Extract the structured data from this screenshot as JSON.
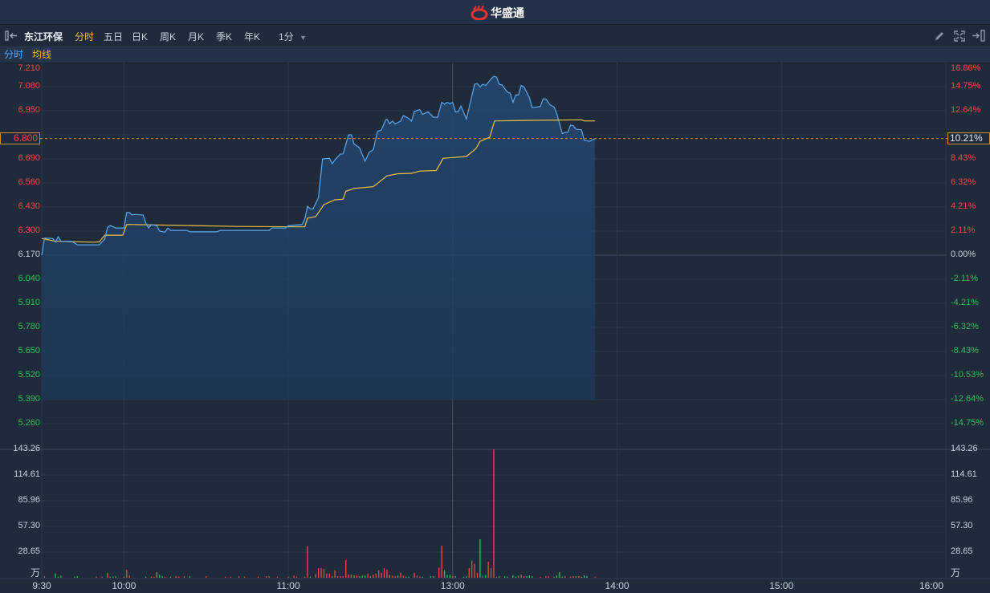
{
  "header": {
    "logo_text": "华盛通"
  },
  "toolbar": {
    "stock_name": "东江环保",
    "tabs": [
      "分时",
      "五日",
      "日K",
      "周K",
      "月K",
      "季K",
      "年K"
    ],
    "active_tab": "分时",
    "interval": "1分"
  },
  "legend": {
    "line1": "分时",
    "line2": "均线"
  },
  "colors": {
    "up": "#e84a4a",
    "down": "#2fbf5c",
    "price_line": "#5aa9f0",
    "avg_line": "#f0c040",
    "accent": "#f0b93a"
  },
  "axis": {
    "price_labels": [
      "7.210",
      "7.080",
      "6.950",
      "",
      "6.690",
      "6.560",
      "6.430",
      "6.300",
      "6.170",
      "6.040",
      "5.910",
      "5.780",
      "5.650",
      "5.520",
      "5.390",
      "5.260"
    ],
    "pct_labels": [
      "16.86%",
      "14.75%",
      "12.64%",
      "",
      "8.43%",
      "6.32%",
      "4.21%",
      "2.11%",
      "0.00%",
      "-2.11%",
      "-4.21%",
      "-6.32%",
      "-8.43%",
      "-10.53%",
      "-12.64%",
      "-14.75%"
    ],
    "volume_labels": [
      "143.26",
      "114.61",
      "85.96",
      "57.30",
      "28.65"
    ],
    "volume_unit": "万",
    "time_labels": [
      "9:30",
      "10:00",
      "11:00",
      "13:00",
      "14:00",
      "15:00",
      "16:00"
    ],
    "current_price": "6.800",
    "current_pct": "10.21%"
  },
  "chart_data": {
    "type": "line",
    "title": "东江环保 分时",
    "prev_close": 6.17,
    "ylim": [
      5.13,
      7.245
    ],
    "x_unit": "trading minutes since 9:30 (11:30/13:00 merged)",
    "xlim": [
      0,
      330
    ],
    "price": [
      [
        0,
        6.17
      ],
      [
        1,
        6.262
      ],
      [
        4,
        6.26
      ],
      [
        5,
        6.24
      ],
      [
        6,
        6.27
      ],
      [
        7,
        6.245
      ],
      [
        11,
        6.245
      ],
      [
        13,
        6.226
      ],
      [
        21,
        6.226
      ],
      [
        23,
        6.257
      ],
      [
        24,
        6.32
      ],
      [
        25,
        6.33
      ],
      [
        27,
        6.317
      ],
      [
        30,
        6.317
      ],
      [
        31,
        6.4
      ],
      [
        32,
        6.4
      ],
      [
        33,
        6.387
      ],
      [
        34,
        6.39
      ],
      [
        37,
        6.387
      ],
      [
        38,
        6.343
      ],
      [
        39,
        6.317
      ],
      [
        40,
        6.335
      ],
      [
        42,
        6.33
      ],
      [
        43,
        6.3
      ],
      [
        45,
        6.295
      ],
      [
        46,
        6.317
      ],
      [
        47,
        6.304
      ],
      [
        53,
        6.304
      ],
      [
        54,
        6.296
      ],
      [
        64,
        6.296
      ],
      [
        65,
        6.304
      ],
      [
        83,
        6.304
      ],
      [
        84,
        6.317
      ],
      [
        89,
        6.317
      ],
      [
        90,
        6.33
      ],
      [
        95,
        6.335
      ],
      [
        96,
        6.365
      ],
      [
        97,
        6.434
      ],
      [
        98,
        6.42
      ],
      [
        99,
        6.42
      ],
      [
        101,
        6.48
      ],
      [
        102.5,
        6.69
      ],
      [
        105,
        6.693
      ],
      [
        106,
        6.664
      ],
      [
        107,
        6.684
      ],
      [
        109,
        6.716
      ],
      [
        110,
        6.717
      ],
      [
        112,
        6.82
      ],
      [
        113,
        6.82
      ],
      [
        114,
        6.77
      ],
      [
        116,
        6.75
      ],
      [
        118,
        6.677
      ],
      [
        119.5,
        6.725
      ],
      [
        121,
        6.74
      ],
      [
        122.5,
        6.837
      ],
      [
        124,
        6.847
      ],
      [
        125.5,
        6.9
      ],
      [
        126,
        6.904
      ],
      [
        127,
        6.88
      ],
      [
        128,
        6.894
      ],
      [
        129,
        6.879
      ],
      [
        131,
        6.894
      ],
      [
        132,
        6.924
      ],
      [
        134,
        6.908
      ],
      [
        135,
        6.894
      ],
      [
        136,
        6.946
      ],
      [
        138,
        6.956
      ],
      [
        139,
        6.93
      ],
      [
        141,
        6.944
      ],
      [
        143,
        6.915
      ],
      [
        144.5,
        6.915
      ],
      [
        146,
        6.996
      ],
      [
        147,
        6.985
      ],
      [
        148,
        6.996
      ],
      [
        149,
        6.988
      ],
      [
        150,
        6.995
      ],
      [
        151,
        6.944
      ],
      [
        152,
        6.944
      ],
      [
        153,
        6.975
      ],
      [
        155,
        6.905
      ],
      [
        158,
        7.093
      ],
      [
        159,
        7.097
      ],
      [
        160,
        7.079
      ],
      [
        161,
        7.093
      ],
      [
        162,
        7.086
      ],
      [
        164,
        7.122
      ],
      [
        165,
        7.136
      ],
      [
        166,
        7.132
      ],
      [
        167,
        7.093
      ],
      [
        168,
        7.089
      ],
      [
        170,
        7.05
      ],
      [
        171,
        7.045
      ],
      [
        172,
        6.996
      ],
      [
        173,
        7.035
      ],
      [
        174,
        7.035
      ],
      [
        175,
        7.086
      ],
      [
        176,
        7.079
      ],
      [
        178,
        7.021
      ],
      [
        179,
        6.967
      ],
      [
        182,
        6.973
      ],
      [
        183,
        7.014
      ],
      [
        184,
        7.014
      ],
      [
        185.5,
        6.982
      ],
      [
        187,
        6.97
      ],
      [
        188,
        6.934
      ],
      [
        190,
        6.826
      ],
      [
        191,
        6.833
      ],
      [
        192,
        6.833
      ],
      [
        193,
        6.872
      ],
      [
        194,
        6.87
      ],
      [
        195,
        6.85
      ],
      [
        197,
        6.847
      ],
      [
        198,
        6.79
      ],
      [
        200,
        6.785
      ],
      [
        201,
        6.793
      ],
      [
        202,
        6.8
      ]
    ],
    "average": [
      [
        0,
        6.26
      ],
      [
        5,
        6.245
      ],
      [
        19,
        6.24
      ],
      [
        21,
        6.242
      ],
      [
        23,
        6.278
      ],
      [
        29.6,
        6.278
      ],
      [
        31,
        6.336
      ],
      [
        55,
        6.33
      ],
      [
        71,
        6.325
      ],
      [
        96,
        6.323
      ],
      [
        97,
        6.37
      ],
      [
        100,
        6.378
      ],
      [
        103,
        6.443
      ],
      [
        107,
        6.469
      ],
      [
        110,
        6.472
      ],
      [
        111,
        6.515
      ],
      [
        114,
        6.53
      ],
      [
        121,
        6.54
      ],
      [
        123,
        6.563
      ],
      [
        126,
        6.598
      ],
      [
        130,
        6.61
      ],
      [
        135,
        6.612
      ],
      [
        138,
        6.624
      ],
      [
        144,
        6.627
      ],
      [
        146.5,
        6.693
      ],
      [
        155,
        6.703
      ],
      [
        158.5,
        6.746
      ],
      [
        160,
        6.785
      ],
      [
        163.5,
        6.807
      ],
      [
        165.3,
        6.895
      ],
      [
        178,
        6.898
      ],
      [
        197,
        6.901
      ],
      [
        198,
        6.895
      ],
      [
        202,
        6.895
      ]
    ],
    "volume_ylim": [
      0,
      143.26
    ],
    "volume": [
      [
        1,
        1.8,
        "up"
      ],
      [
        5,
        4.8,
        "down"
      ],
      [
        6,
        1.2,
        "down"
      ],
      [
        7,
        2.4,
        "down"
      ],
      [
        12,
        1.2,
        "down"
      ],
      [
        13,
        1.8,
        "down"
      ],
      [
        20,
        1.2,
        "up"
      ],
      [
        22,
        1.2,
        "up"
      ],
      [
        24,
        5.4,
        "up"
      ],
      [
        25,
        1.2,
        "down"
      ],
      [
        26,
        1.2,
        "down"
      ],
      [
        27,
        1.8,
        "down"
      ],
      [
        30,
        1.2,
        "up"
      ],
      [
        31,
        9,
        "up"
      ],
      [
        32,
        2.4,
        "up"
      ],
      [
        38,
        1.2,
        "down"
      ],
      [
        40,
        1.2,
        "up"
      ],
      [
        41,
        1.2,
        "up"
      ],
      [
        42,
        6.3,
        "down"
      ],
      [
        43,
        3.3,
        "down"
      ],
      [
        44,
        1.8,
        "down"
      ],
      [
        45,
        1.2,
        "up"
      ],
      [
        47,
        1.2,
        "down"
      ],
      [
        49,
        1.8,
        "up"
      ],
      [
        50,
        1.2,
        "up"
      ],
      [
        52,
        1.8,
        "up"
      ],
      [
        54,
        1.8,
        "down"
      ],
      [
        60,
        1.8,
        "up"
      ],
      [
        67,
        1.2,
        "up"
      ],
      [
        69,
        1.2,
        "up"
      ],
      [
        72,
        1.8,
        "up"
      ],
      [
        74,
        1.2,
        "up"
      ],
      [
        79,
        1.2,
        "up"
      ],
      [
        82,
        1.8,
        "up"
      ],
      [
        83,
        1.8,
        "up"
      ],
      [
        86,
        1.2,
        "up"
      ],
      [
        90,
        1.2,
        "up"
      ],
      [
        92,
        2.4,
        "up"
      ],
      [
        93,
        1.2,
        "up"
      ],
      [
        96,
        1.2,
        "up"
      ],
      [
        97,
        35.2,
        "up"
      ],
      [
        98,
        1.2,
        "down"
      ],
      [
        100,
        3.9,
        "up"
      ],
      [
        101,
        10.7,
        "up"
      ],
      [
        102,
        10.7,
        "up"
      ],
      [
        103,
        10.1,
        "up"
      ],
      [
        104,
        4.8,
        "up"
      ],
      [
        105,
        4.8,
        "up"
      ],
      [
        106,
        1.8,
        "down"
      ],
      [
        107,
        8.4,
        "up"
      ],
      [
        108,
        1.8,
        "up"
      ],
      [
        109,
        1.8,
        "up"
      ],
      [
        110,
        1.8,
        "up"
      ],
      [
        111,
        19.7,
        "up"
      ],
      [
        112,
        3.6,
        "up"
      ],
      [
        113,
        3.6,
        "up"
      ],
      [
        114,
        2.7,
        "down"
      ],
      [
        115,
        2.4,
        "up"
      ],
      [
        116,
        1.8,
        "down"
      ],
      [
        117,
        2.4,
        "down"
      ],
      [
        118,
        2.4,
        "down"
      ],
      [
        119,
        4.8,
        "up"
      ],
      [
        120,
        1.8,
        "up"
      ],
      [
        121,
        3.6,
        "up"
      ],
      [
        122,
        4.8,
        "up"
      ],
      [
        123,
        8.4,
        "up"
      ],
      [
        124,
        5.4,
        "up"
      ],
      [
        125,
        10.7,
        "up"
      ],
      [
        126,
        9.3,
        "up"
      ],
      [
        127,
        3.3,
        "down"
      ],
      [
        128,
        2.4,
        "up"
      ],
      [
        129,
        1.8,
        "up"
      ],
      [
        130,
        2.4,
        "down"
      ],
      [
        131,
        5.7,
        "up"
      ],
      [
        132,
        2.4,
        "up"
      ],
      [
        133,
        1.2,
        "down"
      ],
      [
        134,
        1.2,
        "down"
      ],
      [
        136,
        5.4,
        "up"
      ],
      [
        137,
        2.4,
        "up"
      ],
      [
        138,
        1.2,
        "up"
      ],
      [
        139,
        1.2,
        "down"
      ],
      [
        142,
        1.8,
        "down"
      ],
      [
        143,
        1.8,
        "down"
      ],
      [
        145,
        11.3,
        "up"
      ],
      [
        146,
        35.8,
        "up"
      ],
      [
        147,
        8.4,
        "down"
      ],
      [
        148,
        3.3,
        "down"
      ],
      [
        149,
        3.3,
        "down"
      ],
      [
        150,
        1.8,
        "up"
      ],
      [
        151,
        1.8,
        "down"
      ],
      [
        154,
        1.2,
        "down"
      ],
      [
        155,
        1.8,
        "down"
      ],
      [
        156,
        10.7,
        "up"
      ],
      [
        157,
        19.1,
        "up"
      ],
      [
        158,
        15.5,
        "up"
      ],
      [
        159,
        5.4,
        "up"
      ],
      [
        160,
        43,
        "down"
      ],
      [
        161,
        2.4,
        "up"
      ],
      [
        162,
        3,
        "down"
      ],
      [
        163,
        17.9,
        "up"
      ],
      [
        164,
        10.7,
        "up"
      ],
      [
        165,
        143.26,
        "up"
      ],
      [
        166,
        1.2,
        "up"
      ],
      [
        167,
        1.8,
        "down"
      ],
      [
        169,
        1.8,
        "down"
      ],
      [
        170,
        1.2,
        "down"
      ],
      [
        172,
        2.7,
        "down"
      ],
      [
        173,
        1.2,
        "down"
      ],
      [
        174,
        2.4,
        "up"
      ],
      [
        175,
        3.6,
        "up"
      ],
      [
        176,
        1.8,
        "up"
      ],
      [
        177,
        1.8,
        "down"
      ],
      [
        178,
        2.7,
        "down"
      ],
      [
        179,
        1.8,
        "down"
      ],
      [
        182,
        1.2,
        "up"
      ],
      [
        184,
        1.8,
        "up"
      ],
      [
        185,
        1.8,
        "up"
      ],
      [
        187,
        1.2,
        "down"
      ],
      [
        188,
        2.4,
        "down"
      ],
      [
        189,
        6.3,
        "down"
      ],
      [
        190,
        1.2,
        "down"
      ],
      [
        191,
        1.8,
        "up"
      ],
      [
        193,
        1.2,
        "up"
      ],
      [
        194,
        1.8,
        "up"
      ],
      [
        195,
        1.8,
        "down"
      ],
      [
        196,
        1.8,
        "up"
      ],
      [
        197,
        1.2,
        "down"
      ],
      [
        198,
        2.7,
        "down"
      ],
      [
        199,
        1.8,
        "down"
      ],
      [
        202,
        1.2,
        "up"
      ]
    ]
  }
}
